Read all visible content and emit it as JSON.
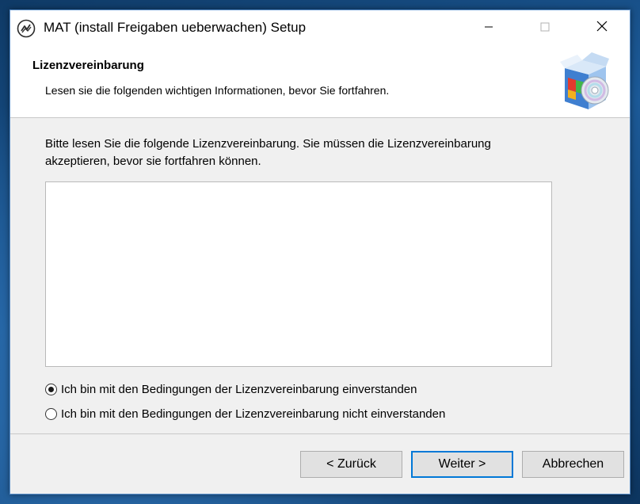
{
  "window": {
    "title": "MAT (install Freigaben ueberwachen) Setup",
    "icons": {
      "app": "app-logo-icon",
      "minimize": "minimize-icon",
      "maximize": "maximize-icon",
      "close": "close-icon"
    }
  },
  "header": {
    "title": "Lizenzvereinbarung",
    "subtitle": "Lesen sie die folgenden wichtigen Informationen, bevor Sie fortfahren.",
    "icon": "installer-box-cd-icon"
  },
  "body": {
    "intro": "Bitte lesen Sie die folgende Lizenzvereinbarung. Sie müssen die Lizenzvereinbarung akzeptieren, bevor sie fortfahren können.",
    "license_text": "",
    "options": [
      {
        "label": "Ich bin mit den Bedingungen der Lizenzvereinbarung einverstanden",
        "selected": true
      },
      {
        "label": "Ich bin mit den Bedingungen der Lizenzvereinbarung nicht einverstanden",
        "selected": false
      }
    ]
  },
  "footer": {
    "back_label": "< Zurück",
    "next_label": "Weiter >",
    "cancel_label": "Abbrechen"
  },
  "colors": {
    "accent": "#0078d7",
    "window_bg": "#f0f0f0",
    "header_bg": "#ffffff"
  }
}
